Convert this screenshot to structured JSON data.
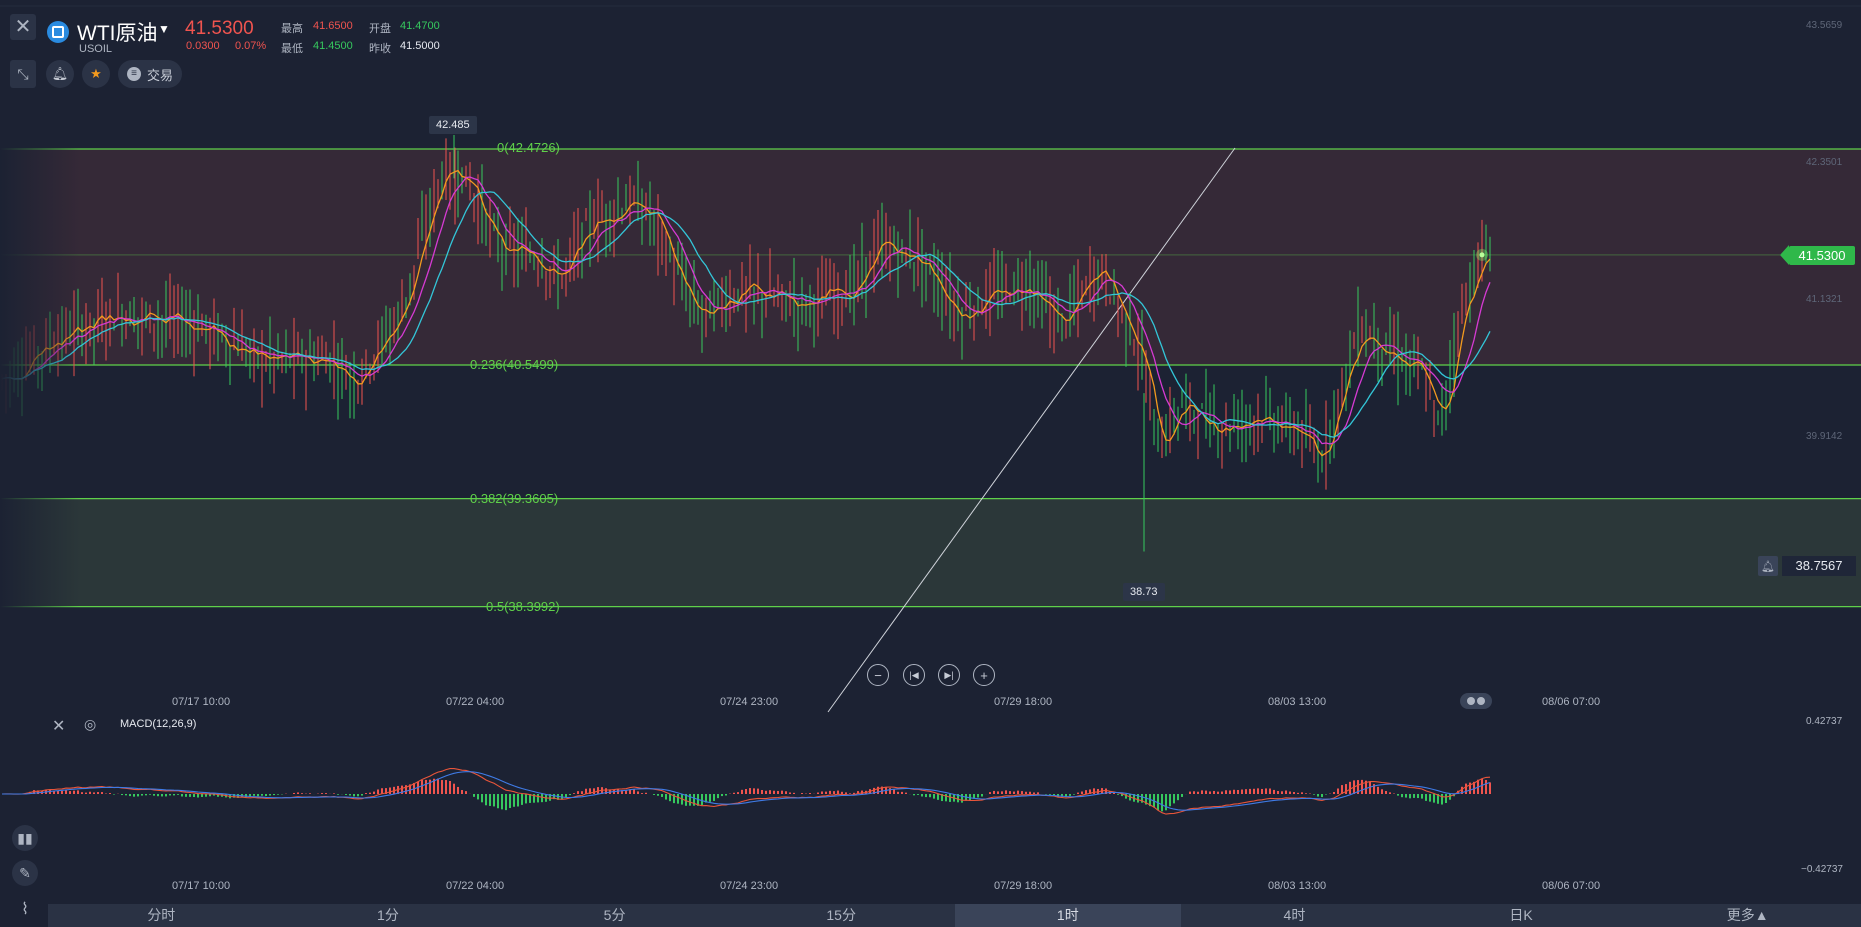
{
  "header": {
    "symbol_name": "WTI原油",
    "symbol_code": "USOIL",
    "price": "41.5300",
    "change": "0.0300",
    "change_pct": "0.07%",
    "quotes": [
      {
        "label": "最高",
        "value": "41.6500",
        "color": "#f0544f"
      },
      {
        "label": "开盘",
        "value": "41.4700",
        "color": "#36c95e"
      },
      {
        "label": "最低",
        "value": "41.4500",
        "color": "#36c95e"
      },
      {
        "label": "昨收",
        "value": "41.5000",
        "color": "#e7eaf0"
      }
    ]
  },
  "toolbar": {
    "trade_label": "交易"
  },
  "price_axis": [
    "43.5659",
    "42.3501",
    "41.1321",
    "39.9142"
  ],
  "current_price_tag": "41.5300",
  "alert_price_tag": "38.7567",
  "extreme_labels": {
    "high": "42.485",
    "low": "38.73"
  },
  "fib_levels": [
    {
      "label": "0(42.4726)",
      "price": 42.4726
    },
    {
      "label": "0.236(40.5499)",
      "price": 40.5499
    },
    {
      "label": "0.382(39.3605)",
      "price": 39.3605
    },
    {
      "label": "0.5(38.3992)",
      "price": 38.3992
    }
  ],
  "x_axis_labels": [
    "07/17 10:00",
    "07/22 04:00",
    "07/24 23:00",
    "07/29 18:00",
    "08/03 13:00",
    "08/06 07:00"
  ],
  "macd": {
    "title": "MACD(12,26,9)",
    "axis_top": "0.42737",
    "axis_bottom": "−0.42737"
  },
  "timeframes": [
    "分时",
    "1分",
    "5分",
    "15分",
    "1时",
    "4时",
    "日K",
    "更多▲"
  ],
  "active_timeframe": "1时",
  "colors": {
    "up": "#f0544f",
    "down": "#36c95e",
    "fib": "#5fd14a",
    "ma_orange": "#f39a1e",
    "ma_magenta": "#d63ad3",
    "ma_cyan": "#33c6d8",
    "accent_green": "#2fb84a"
  }
}
